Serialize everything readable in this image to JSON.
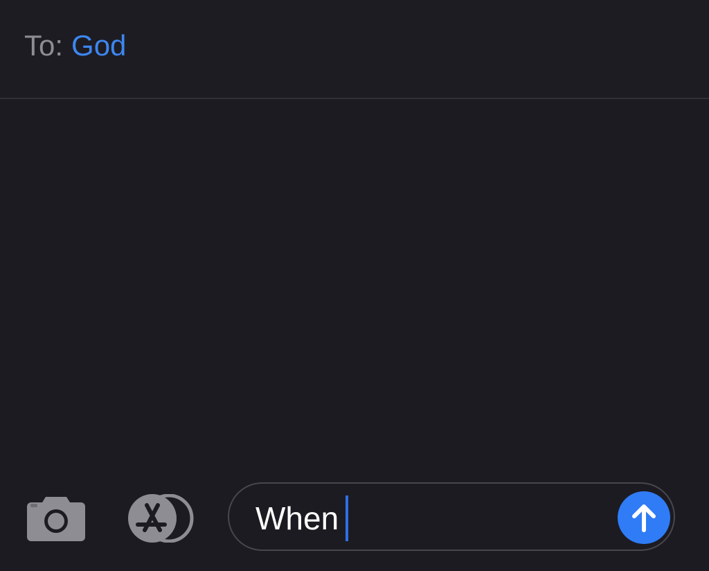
{
  "header": {
    "to_label": "To:",
    "recipient": "God"
  },
  "composer": {
    "text": "When",
    "camera_icon": "camera-icon",
    "apps_icon": "app-store-icon",
    "send_icon": "arrow-up-icon"
  },
  "colors": {
    "background": "#1c1b21",
    "recipient_blue": "#3d86f0",
    "send_blue": "#2f7cf6",
    "caret_blue": "#2f6ee8",
    "label_gray": "#8e8d93"
  }
}
